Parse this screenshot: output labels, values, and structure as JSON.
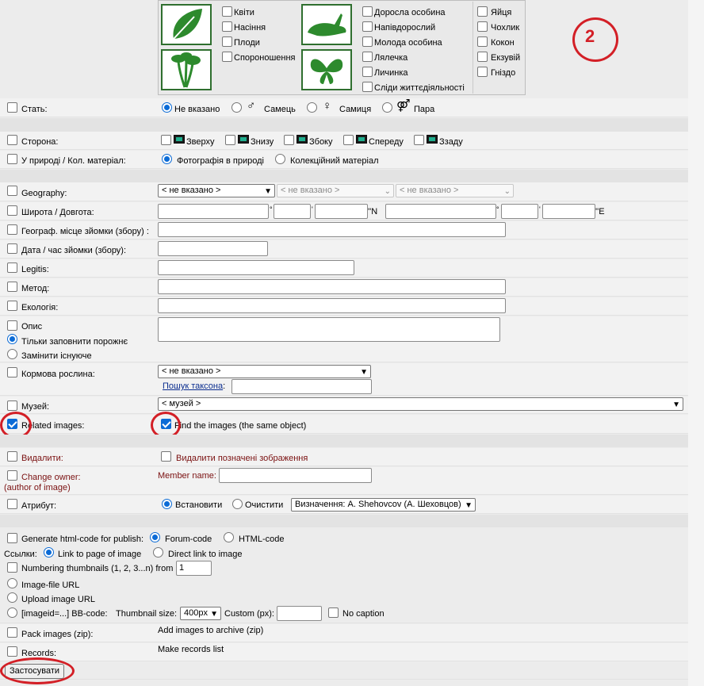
{
  "annotation": {
    "number": "2"
  },
  "categories": {
    "plant": [
      "Квіти",
      "Насіння",
      "Плоди",
      "Спороношення"
    ],
    "animal": [
      "Доросла особина",
      "Напівдорослий",
      "Молода особина",
      "Лялечка",
      "Личинка",
      "Сліди життєдіяльності"
    ],
    "animal_extra": [
      "Яйця",
      "Чохлик",
      "Кокон",
      "Екзувій",
      "Гніздо"
    ],
    "icons": [
      "leaf-icon",
      "mushroom-icon",
      "hare-icon",
      "butterfly-icon"
    ]
  },
  "sex": {
    "label": "Стать:",
    "options": [
      "Не вказано",
      "Самець",
      "Самиця",
      "Пара"
    ],
    "symbols": [
      "♂",
      "♀",
      "⚤"
    ]
  },
  "side": {
    "label": "Сторона:",
    "options": [
      "Зверху",
      "Знизу",
      "Збоку",
      "Спереду",
      "Ззаду"
    ]
  },
  "nature": {
    "label": "У природі / Кол. матеріал:",
    "options": [
      "Фотографія в природі",
      "Колекційний матеріал"
    ]
  },
  "geography": {
    "label": "Geography:",
    "select1": "< не вказано >",
    "select2": "< не вказано >",
    "select3": "< не вказано >"
  },
  "coords": {
    "label": "Широта / Довгота:",
    "deg": "°",
    "min": "'",
    "n": "''N",
    "e": "''E"
  },
  "place": {
    "label": "Географ. місце зйомки (збору) :"
  },
  "date": {
    "label": "Дата / час зйомки (збору):"
  },
  "legit": {
    "label": "Legitis:"
  },
  "method": {
    "label": "Метод:"
  },
  "ecology": {
    "label": "Екологія:"
  },
  "description": {
    "label": "Опис",
    "option1": "Тільки заповнити порожнє",
    "option2": "Замінити існуюче"
  },
  "food_plant": {
    "label": "Кормова рослина:",
    "select": "< не вказано >",
    "search_link": "Пошук таксона",
    "colon": ":"
  },
  "museum": {
    "label": "Музей:",
    "select": "< музей >"
  },
  "related": {
    "label": "Related images:",
    "find_label": "Find the images (the same object)"
  },
  "delete": {
    "label": "Видалити:",
    "option": "Видалити позначені зображення"
  },
  "owner": {
    "label": "Change owner:",
    "sublabel": "(author of image)",
    "member_label": "Member name:"
  },
  "attribute": {
    "label": "Атрибут:",
    "set": "Встановити",
    "clear": "Очистити",
    "select": "Визначення: A. Shehovcov (А. Шеховцов)"
  },
  "publish": {
    "label": "Generate html-code for publish:",
    "forum": "Forum-code",
    "html": "HTML-code",
    "links_label": "Ссылки:",
    "link_page": "Link to page of image",
    "link_direct": "Direct link to image",
    "numbering": "Numbering thumbnails (1, 2, 3...n) from",
    "numbering_value": "1",
    "image_file_url": "Image-file URL",
    "upload_url": "Upload image URL",
    "bbcode": "[imageid=...] BB-code:",
    "thumb_size_label": "Thumbnail size:",
    "thumb_size": "400px",
    "custom_label": "Custom (px):",
    "no_caption": "No caption"
  },
  "pack": {
    "label": "Pack images (zip):",
    "note": "Add images to archive (zip)"
  },
  "records": {
    "label": "Records:",
    "note": "Make records list"
  },
  "apply_button": "Застосувати",
  "colors": {
    "accent": "#0b6bd6",
    "highlight": "#d31f26",
    "green": "#2f6f2f"
  }
}
